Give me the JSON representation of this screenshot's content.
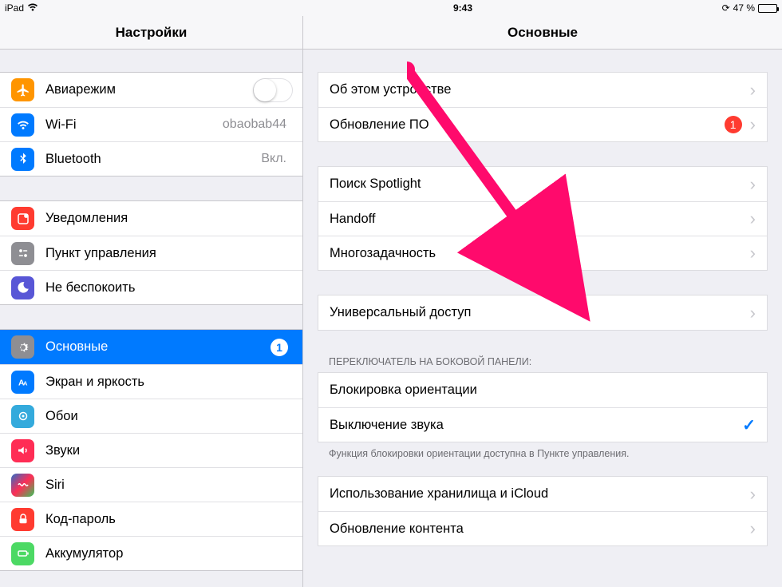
{
  "status": {
    "device": "iPad",
    "time": "9:43",
    "battery_pct": "47 %"
  },
  "headers": {
    "left": "Настройки",
    "right": "Основные"
  },
  "sidebar": {
    "g1": [
      {
        "name": "airplane",
        "label": "Авиарежим",
        "detail": "",
        "toggle": true
      },
      {
        "name": "wifi",
        "label": "Wi-Fi",
        "detail": "obaobab44"
      },
      {
        "name": "bluetooth",
        "label": "Bluetooth",
        "detail": "Вкл."
      }
    ],
    "g2": [
      {
        "name": "notifications",
        "label": "Уведомления"
      },
      {
        "name": "control-center",
        "label": "Пункт управления"
      },
      {
        "name": "dnd",
        "label": "Не беспокоить"
      }
    ],
    "g3": [
      {
        "name": "general",
        "label": "Основные",
        "badge": "1",
        "selected": true
      },
      {
        "name": "display",
        "label": "Экран и яркость"
      },
      {
        "name": "wallpaper",
        "label": "Обои"
      },
      {
        "name": "sounds",
        "label": "Звуки"
      },
      {
        "name": "siri",
        "label": "Siri"
      },
      {
        "name": "passcode",
        "label": "Код-пароль"
      },
      {
        "name": "battery",
        "label": "Аккумулятор"
      }
    ]
  },
  "detail": {
    "g1": [
      {
        "name": "about",
        "label": "Об этом устройстве"
      },
      {
        "name": "software-update",
        "label": "Обновление ПО",
        "badge": "1"
      }
    ],
    "g2": [
      {
        "name": "spotlight",
        "label": "Поиск Spotlight"
      },
      {
        "name": "handoff",
        "label": "Handoff"
      },
      {
        "name": "multitasking",
        "label": "Многозадачность"
      }
    ],
    "g3": [
      {
        "name": "accessibility",
        "label": "Универсальный доступ"
      }
    ],
    "side_switch_header": "ПЕРЕКЛЮЧАТЕЛЬ НА БОКОВОЙ ПАНЕЛИ:",
    "g4": [
      {
        "name": "lock-rotation",
        "label": "Блокировка ориентации",
        "checked": false
      },
      {
        "name": "mute",
        "label": "Выключение звука",
        "checked": true
      }
    ],
    "side_switch_footer": "Функция блокировки ориентации доступна в Пункте управления.",
    "g5": [
      {
        "name": "storage-icloud",
        "label": "Использование хранилища и iCloud"
      },
      {
        "name": "background-refresh",
        "label": "Обновление контента"
      }
    ]
  }
}
